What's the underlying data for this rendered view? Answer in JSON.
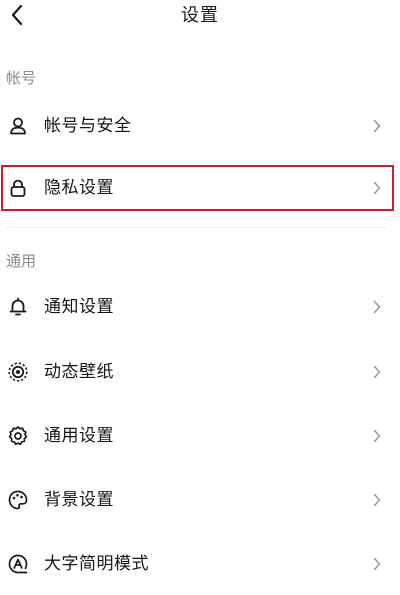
{
  "header": {
    "title": "设置",
    "back_icon": "chevron-left-icon"
  },
  "sections": [
    {
      "label": "帐号",
      "items": [
        {
          "label": "帐号与安全",
          "icon": "user-icon"
        },
        {
          "label": "隐私设置",
          "icon": "lock-icon",
          "highlighted": true
        }
      ]
    },
    {
      "label": "通用",
      "items": [
        {
          "label": "通知设置",
          "icon": "bell-icon"
        },
        {
          "label": "动态壁纸",
          "icon": "live-wallpaper-icon"
        },
        {
          "label": "通用设置",
          "icon": "gear-icon"
        },
        {
          "label": "背景设置",
          "icon": "palette-icon"
        },
        {
          "label": "大字简明模式",
          "icon": "text-mode-icon"
        }
      ]
    }
  ],
  "colors": {
    "highlight": "#cc1f26",
    "section_label": "#8a8a8a",
    "chevron": "#9a9a9a"
  }
}
